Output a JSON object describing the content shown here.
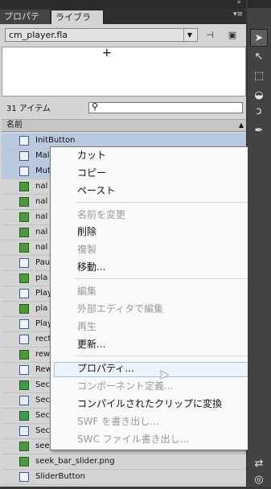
{
  "tabs": [
    {
      "label": "プロパティ"
    },
    {
      "label": "ライブラリ"
    }
  ],
  "document": {
    "name": "cm_player.fla"
  },
  "preview": {
    "marker": "+"
  },
  "count": "31 アイテム",
  "search": {
    "placeholder": ""
  },
  "list": {
    "header": "名前",
    "items": [
      {
        "name": "InitButton",
        "icon": "button"
      },
      {
        "name": "Mal",
        "icon": "button"
      },
      {
        "name": "Mut",
        "icon": "button"
      },
      {
        "name": "nal",
        "icon": "bitmap"
      },
      {
        "name": "nal",
        "icon": "bitmap"
      },
      {
        "name": "nal",
        "icon": "bitmap"
      },
      {
        "name": "nal",
        "icon": "bitmap"
      },
      {
        "name": "nal",
        "icon": "bitmap"
      },
      {
        "name": "Pau",
        "icon": "button"
      },
      {
        "name": "pla",
        "icon": "bitmap"
      },
      {
        "name": "Play",
        "icon": "button"
      },
      {
        "name": "pla",
        "icon": "bitmap"
      },
      {
        "name": "Play",
        "icon": "button"
      },
      {
        "name": "rect",
        "icon": "button"
      },
      {
        "name": "rew",
        "icon": "bitmap"
      },
      {
        "name": "Rew",
        "icon": "button"
      },
      {
        "name": "Sec",
        "icon": "green"
      },
      {
        "name": "Sec",
        "icon": "movieclip"
      },
      {
        "name": "Sec",
        "icon": "green"
      },
      {
        "name": "Sec",
        "icon": "movieclip"
      },
      {
        "name": "seek",
        "icon": "bitmap"
      },
      {
        "name": "seek_bar_slider.png",
        "icon": "bitmap"
      },
      {
        "name": "SliderButton",
        "icon": "button"
      }
    ]
  },
  "context_menu": {
    "items": [
      {
        "label": "カット",
        "enabled": true
      },
      {
        "label": "コピー",
        "enabled": true
      },
      {
        "label": "ペースト",
        "enabled": true
      },
      {
        "label": "名前を変更",
        "enabled": false
      },
      {
        "label": "削除",
        "enabled": true
      },
      {
        "label": "複製",
        "enabled": false
      },
      {
        "label": "移動...",
        "enabled": true
      },
      {
        "label": "編集",
        "enabled": false
      },
      {
        "label": "外部エディタで編集",
        "enabled": false
      },
      {
        "label": "再生",
        "enabled": false
      },
      {
        "label": "更新...",
        "enabled": true
      },
      {
        "label": "プロパティ...",
        "enabled": true,
        "highlighted": true
      },
      {
        "label": "コンポーネント定義...",
        "enabled": false
      },
      {
        "label": "コンパイルされたクリップに変換",
        "enabled": true
      },
      {
        "label": "SWF を書き出し...",
        "enabled": false
      },
      {
        "label": "SWC ファイル書き出し...",
        "enabled": false
      }
    ]
  },
  "tools": [
    "selection-tool",
    "subselection-tool",
    "free-transform-tool",
    "3d-rotation-tool",
    "lasso-tool",
    "pen-tool"
  ],
  "colors": {
    "highlight": "#eef3fb",
    "selected_row": "#b9c9e0"
  }
}
